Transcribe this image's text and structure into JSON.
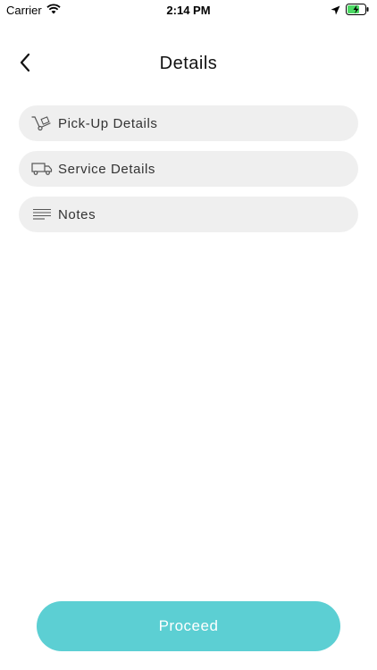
{
  "status_bar": {
    "carrier": "Carrier",
    "time": "2:14 PM",
    "icons": [
      "wifi-icon",
      "location-arrow-icon",
      "battery-charging-icon"
    ]
  },
  "header": {
    "title": "Details",
    "back_icon": "chevron-left-icon"
  },
  "menu": {
    "items": [
      {
        "label": "Pick-Up Details",
        "icon": "hand-truck-icon"
      },
      {
        "label": "Service Details",
        "icon": "truck-icon"
      },
      {
        "label": "Notes",
        "icon": "notes-lines-icon"
      }
    ]
  },
  "footer": {
    "proceed_label": "Proceed"
  },
  "colors": {
    "accent": "#5ccfd3",
    "item_background": "#efefef",
    "battery_green": "#4cd964"
  }
}
